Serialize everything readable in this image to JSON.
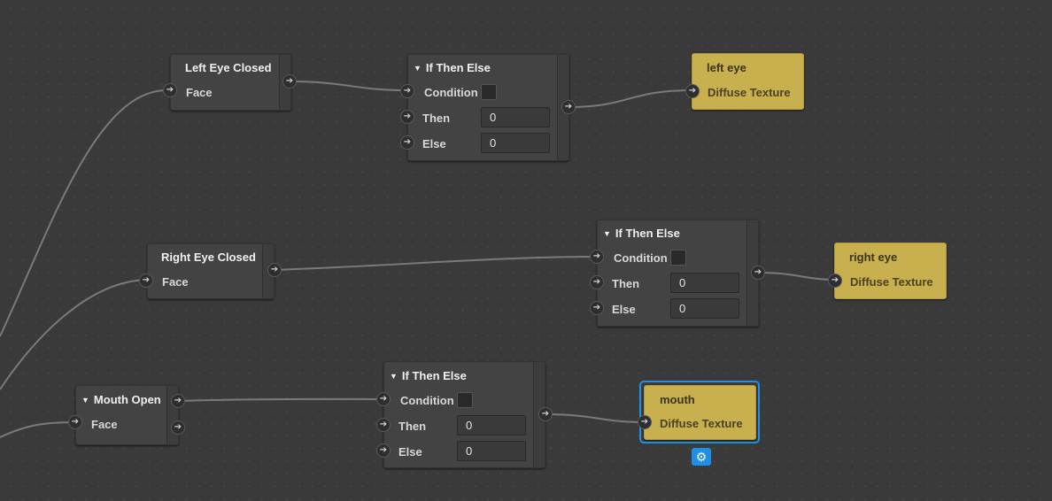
{
  "nodes": {
    "left_eye_closed": {
      "title": "Left Eye Closed",
      "port": "Face"
    },
    "right_eye_closed": {
      "title": "Right Eye Closed",
      "port": "Face"
    },
    "mouth_open": {
      "title": "Mouth Open",
      "port": "Face"
    },
    "if1": {
      "title": "If Then Else",
      "condition": "Condition",
      "then": "Then",
      "else": "Else",
      "then_value": "0",
      "else_value": "0"
    },
    "if2": {
      "title": "If Then Else",
      "condition": "Condition",
      "then": "Then",
      "else": "Else",
      "then_value": "0",
      "else_value": "0"
    },
    "if3": {
      "title": "If Then Else",
      "condition": "Condition",
      "then": "Then",
      "else": "Else",
      "then_value": "0",
      "else_value": "0"
    },
    "left_eye": {
      "title": "left eye",
      "port": "Diffuse Texture"
    },
    "right_eye": {
      "title": "right eye",
      "port": "Diffuse Texture"
    },
    "mouth": {
      "title": "mouth",
      "port": "Diffuse Texture"
    }
  },
  "icons": {
    "port": "arrow-right-icon",
    "collapse": "triangle-down-icon",
    "settings": "gear-icon"
  },
  "colors": {
    "canvas": "#2b2b2b",
    "node": "#434343",
    "material_node": "#c8b04e",
    "selection": "#1e90e8"
  }
}
